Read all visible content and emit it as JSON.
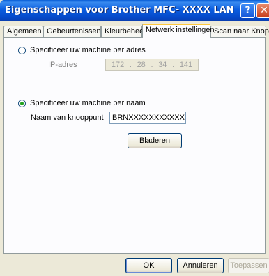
{
  "window": {
    "title": "Eigenschappen voor Brother MFC- XXXX   LAN",
    "help_glyph": "?",
    "close_glyph": "✕"
  },
  "tabs": [
    {
      "label": "Algemeen"
    },
    {
      "label": "Gebeurtenissen"
    },
    {
      "label": "Kleurbeheer"
    },
    {
      "label": "Netwerk instellingen"
    },
    {
      "label": "Scan naar Knop"
    }
  ],
  "active_tab": "Netwerk instellingen",
  "by_address": {
    "label": "Specificeer uw machine per adres",
    "selected": false,
    "ip_label": "IP-adres",
    "ip_octets": [
      "172",
      "28",
      "34",
      "141"
    ]
  },
  "by_name": {
    "label": "Specificeer uw machine per naam",
    "selected": true,
    "node_label": "Naam van knooppunt",
    "node_value": "BRNXXXXXXXXXXXX",
    "browse_label": "Bladeren"
  },
  "footer": {
    "ok_label": "OK",
    "cancel_label": "Annuleren",
    "apply_label": "Toepassen"
  }
}
